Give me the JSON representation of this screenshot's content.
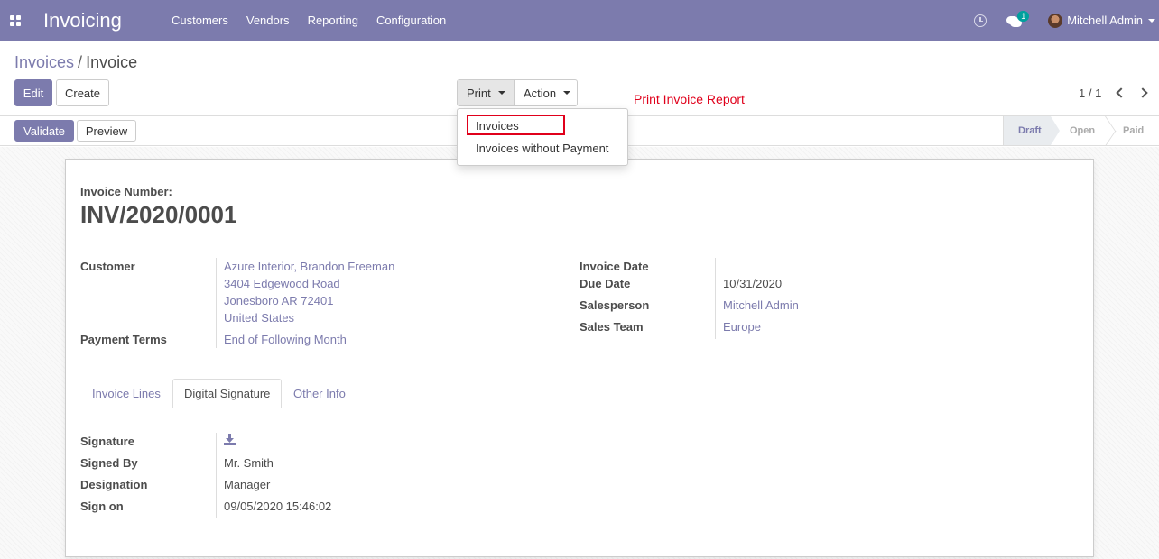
{
  "app": {
    "title": "Invoicing"
  },
  "nav": {
    "menu": [
      "Customers",
      "Vendors",
      "Reporting",
      "Configuration"
    ],
    "messages_badge": "1",
    "user": "Mitchell Admin"
  },
  "breadcrumb": {
    "parent": "Invoices",
    "separator": "/",
    "current": "Invoice"
  },
  "toolbar": {
    "edit": "Edit",
    "create": "Create",
    "print": "Print",
    "action": "Action",
    "pager": "1 / 1"
  },
  "print_menu": {
    "items": [
      "Invoices",
      "Invoices without Payment"
    ]
  },
  "annotation": "Print Invoice Report",
  "statusbar": {
    "validate": "Validate",
    "preview": "Preview",
    "stages": [
      "Draft",
      "Open",
      "Paid"
    ]
  },
  "invoice": {
    "number_label": "Invoice Number:",
    "number": "INV/2020/0001",
    "customer_label": "Customer",
    "customer_lines": [
      "Azure Interior, Brandon Freeman",
      "3404 Edgewood Road",
      "Jonesboro AR 72401",
      "United States"
    ],
    "payment_terms_label": "Payment Terms",
    "payment_terms": "End of Following Month",
    "invoice_date_label": "Invoice Date",
    "invoice_date": "",
    "due_date_label": "Due Date",
    "due_date": "10/31/2020",
    "salesperson_label": "Salesperson",
    "salesperson": "Mitchell Admin",
    "sales_team_label": "Sales Team",
    "sales_team": "Europe"
  },
  "tabs": [
    "Invoice Lines",
    "Digital Signature",
    "Other Info"
  ],
  "signature": {
    "signature_label": "Signature",
    "signed_by_label": "Signed By",
    "signed_by": "Mr. Smith",
    "designation_label": "Designation",
    "designation": "Manager",
    "sign_on_label": "Sign on",
    "sign_on": "09/05/2020 15:46:02"
  }
}
